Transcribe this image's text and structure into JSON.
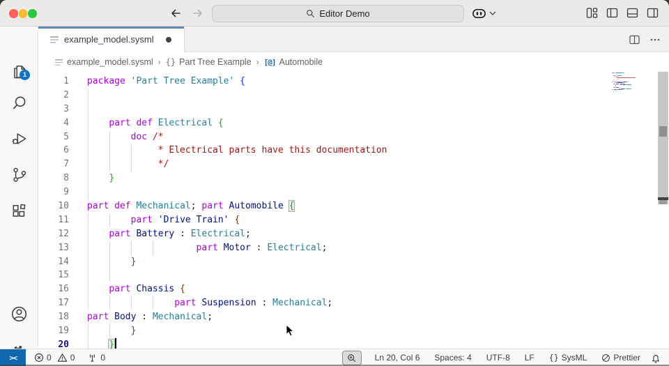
{
  "title_bar": {
    "search_title": "Editor Demo"
  },
  "tab_bar": {
    "tab_label": "example_model.sysml"
  },
  "breadcrumb": {
    "file": "example_model.sysml",
    "separator": "›",
    "namespace_glyph": "{}",
    "package": "Part Tree Example",
    "symbol_glyph": "[@]",
    "symbol": "Automobile"
  },
  "editor": {
    "cursor_line": 20,
    "lines": [
      {
        "n": "1",
        "guides": [],
        "tokens": [
          [
            "kw",
            "package"
          ],
          [
            "pl",
            " "
          ],
          [
            "type",
            "'Part Tree Example'"
          ],
          [
            "pl",
            " "
          ],
          [
            "b1",
            "{"
          ]
        ]
      },
      {
        "n": "2",
        "guides": [
          0
        ],
        "tokens": []
      },
      {
        "n": "3",
        "guides": [
          0
        ],
        "tokens": []
      },
      {
        "n": "4",
        "guides": [
          0
        ],
        "tokens": [
          [
            "pl",
            "    "
          ],
          [
            "kw",
            "part"
          ],
          [
            "pl",
            " "
          ],
          [
            "kw",
            "def"
          ],
          [
            "pl",
            " "
          ],
          [
            "type",
            "Electrical"
          ],
          [
            "pl",
            " "
          ],
          [
            "b2",
            "{"
          ]
        ]
      },
      {
        "n": "5",
        "guides": [
          0,
          4
        ],
        "tokens": [
          [
            "pl",
            "        "
          ],
          [
            "kw",
            "doc"
          ],
          [
            "pl",
            " "
          ],
          [
            "cm",
            "/*"
          ]
        ]
      },
      {
        "n": "6",
        "guides": [
          0,
          4,
          8
        ],
        "tokens": [
          [
            "pl",
            "             "
          ],
          [
            "cm",
            "* Electrical parts have this documentation"
          ]
        ]
      },
      {
        "n": "7",
        "guides": [
          0,
          4,
          8
        ],
        "tokens": [
          [
            "pl",
            "             "
          ],
          [
            "cm",
            "*/"
          ]
        ]
      },
      {
        "n": "8",
        "guides": [
          0
        ],
        "tokens": [
          [
            "pl",
            "    "
          ],
          [
            "b2",
            "}"
          ]
        ]
      },
      {
        "n": "9",
        "guides": [
          0
        ],
        "tokens": []
      },
      {
        "n": "10",
        "guides": [],
        "tokens": [
          [
            "kw",
            "part"
          ],
          [
            "pl",
            " "
          ],
          [
            "kw",
            "def"
          ],
          [
            "pl",
            " "
          ],
          [
            "type",
            "Mechanical"
          ],
          [
            "pn",
            ";"
          ],
          [
            "pl",
            " "
          ],
          [
            "kw",
            "part"
          ],
          [
            "pl",
            " "
          ],
          [
            "nm",
            "Automobile"
          ],
          [
            "pl",
            " "
          ],
          [
            "b2m",
            "{"
          ]
        ]
      },
      {
        "n": "11",
        "guides": [
          0,
          4
        ],
        "tokens": [
          [
            "pl",
            "        "
          ],
          [
            "kw",
            "part"
          ],
          [
            "pl",
            " "
          ],
          [
            "nm",
            "'Drive Train'"
          ],
          [
            "pl",
            " "
          ],
          [
            "b3",
            "{"
          ]
        ]
      },
      {
        "n": "12",
        "guides": [
          0
        ],
        "tokens": [
          [
            "pl",
            "    "
          ],
          [
            "kw",
            "part"
          ],
          [
            "pl",
            " "
          ],
          [
            "nm",
            "Battery"
          ],
          [
            "pl",
            " "
          ],
          [
            "pn",
            ":"
          ],
          [
            "pl",
            " "
          ],
          [
            "type",
            "Electrical"
          ],
          [
            "pn",
            ";"
          ]
        ]
      },
      {
        "n": "13",
        "guides": [
          0,
          4,
          8,
          12
        ],
        "tokens": [
          [
            "pl",
            "                    "
          ],
          [
            "kw",
            "part"
          ],
          [
            "pl",
            " "
          ],
          [
            "nm",
            "Motor"
          ],
          [
            "pl",
            " "
          ],
          [
            "pn",
            ":"
          ],
          [
            "pl",
            " "
          ],
          [
            "type",
            "Electrical"
          ],
          [
            "pn",
            ";"
          ]
        ]
      },
      {
        "n": "14",
        "guides": [
          0,
          4
        ],
        "tokens": [
          [
            "pl",
            "        "
          ],
          [
            "b3",
            "}"
          ]
        ]
      },
      {
        "n": "15",
        "guides": [
          0,
          4
        ],
        "tokens": []
      },
      {
        "n": "16",
        "guides": [
          0
        ],
        "tokens": [
          [
            "pl",
            "    "
          ],
          [
            "kw",
            "part"
          ],
          [
            "pl",
            " "
          ],
          [
            "nm",
            "Chassis"
          ],
          [
            "pl",
            " "
          ],
          [
            "b3",
            "{"
          ]
        ]
      },
      {
        "n": "17",
        "guides": [
          0,
          4,
          8,
          12
        ],
        "tokens": [
          [
            "pl",
            "                "
          ],
          [
            "kw",
            "part"
          ],
          [
            "pl",
            " "
          ],
          [
            "nm",
            "Suspension"
          ],
          [
            "pl",
            " "
          ],
          [
            "pn",
            ":"
          ],
          [
            "pl",
            " "
          ],
          [
            "type",
            "Mechanical"
          ],
          [
            "pn",
            ";"
          ]
        ]
      },
      {
        "n": "18",
        "guides": [],
        "tokens": [
          [
            "kw",
            "part"
          ],
          [
            "pl",
            " "
          ],
          [
            "nm",
            "Body"
          ],
          [
            "pl",
            " "
          ],
          [
            "pn",
            ":"
          ],
          [
            "pl",
            " "
          ],
          [
            "type",
            "Mechanical"
          ],
          [
            "pn",
            ";"
          ]
        ]
      },
      {
        "n": "19",
        "guides": [
          0,
          4
        ],
        "tokens": [
          [
            "pl",
            "        "
          ],
          [
            "b3",
            "}"
          ]
        ]
      },
      {
        "n": "20",
        "guides": [
          0
        ],
        "tokens": [
          [
            "pl",
            "    "
          ],
          [
            "b2m",
            "}"
          ]
        ],
        "cursor": true
      }
    ]
  },
  "status_bar": {
    "errors": "0",
    "warnings": "0",
    "ports": "0",
    "cursor_position": "Ln 20, Col 6",
    "indentation": "Spaces: 4",
    "encoding": "UTF-8",
    "eol": "LF",
    "language_glyph": "{}",
    "language": "SysML",
    "formatter": "Prettier"
  },
  "colors": {
    "keyword": "#AF00DB",
    "type_name": "#267F99",
    "declared_name": "#001080",
    "doc_comment": "#A31515",
    "bracket_level1": "#0431FA",
    "bracket_level2": "#319331",
    "bracket_level3": "#7B3814",
    "line_number": "#6E7681",
    "active_line_number": "#171184",
    "tab_accent_top": "#5b87b5",
    "badge_blue": "#1273c4",
    "remote_blue": "#1068b0"
  }
}
